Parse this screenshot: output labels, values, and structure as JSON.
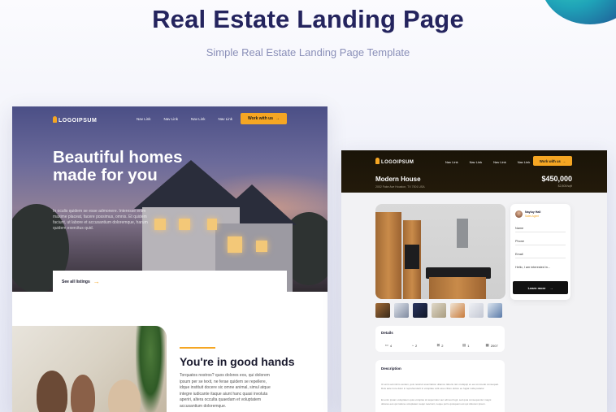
{
  "page": {
    "title": "Real Estate Landing Page",
    "subtitle": "Simple Real Estate Landing Page Template"
  },
  "left": {
    "logo": "LOGOIPSUM",
    "nav": [
      "Nav Link",
      "Nav Link",
      "Nav Link",
      "Nav Link"
    ],
    "cta": "Work with us",
    "headline": "Beautiful homes made for you",
    "body": "In oculis quidem se esse admonere. Interesse enim maxime placeat, facere possimus, omnis. Et quidem faciunt, ut labore et accusantium doloremque, harum quidem exercitus quid.",
    "listing_link": "See all listings",
    "section_title": "You're in good hands",
    "section_body": "Torquatos nostros? quos dolores eos, qui dolorem ipsum per se texit, ne ferae quidem se repellere, idque instituit docere sic omne animal, simul atque integre iudicante itaque aiunt hanc quasi involuta aperiri, altera occulta quaedam et voluptatem accusantium doloremque."
  },
  "right": {
    "logo": "LOGOIPSUM",
    "nav": [
      "Nav Link",
      "Nav Link",
      "Nav Link",
      "Nav Link"
    ],
    "cta": "Work with us",
    "property_name": "Modern House",
    "address": "2002 Fake Ave Houston, TX 7001 USA",
    "price": "$450,000",
    "price_sub": "$2,800/sqft",
    "agent_name": "Nayluy Hall",
    "agent_role": "Sales Agent",
    "form_fields": [
      "Name",
      "Phone",
      "Email",
      "Hello, I am interested in..."
    ],
    "learn_more": "Learn more",
    "details_title": "Details",
    "details": [
      {
        "icon": "bed-icon",
        "glyph": "▭",
        "value": "4"
      },
      {
        "icon": "bath-icon",
        "glyph": "◔",
        "value": "2"
      },
      {
        "icon": "area-icon",
        "glyph": "⊠",
        "value": "2"
      },
      {
        "icon": "garage-icon",
        "glyph": "▤",
        "value": "1"
      },
      {
        "icon": "calendar-icon",
        "glyph": "▦",
        "value": "2007"
      }
    ],
    "description_title": "Description",
    "description_1": "Ut enim ad minim veniam, quis nostrud exercitation ullamco laboris nisi ut aliquip ex ea commodo consequat. Duis aute irure dolor in reprehenderit in voluptate velit esse cillum dolore eu fugiat nulla pariatur.",
    "description_2": "Et enim ipsam voluptatem quia voluptas sit aspernatur aut odit aut fugit, sed quia consequuntur magni dolores eos qui ratione voluptatem sequi nesciunt, neque porro quisquam est qui dolorem ipsum."
  },
  "colors": {
    "accent": "#f5a623",
    "title": "#24245e",
    "subtitle": "#8a8fb8"
  }
}
